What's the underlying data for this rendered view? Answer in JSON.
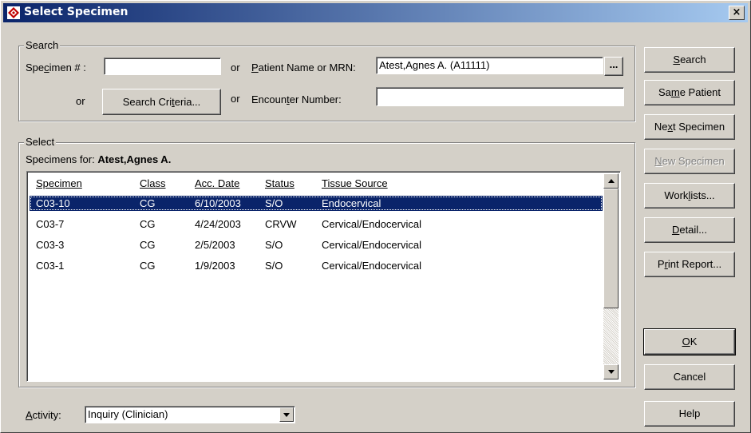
{
  "window": {
    "title": "Select Specimen",
    "close_label": "×"
  },
  "search": {
    "group_label": "Search",
    "specimen_label_pre": "Spe",
    "specimen_label_u": "c",
    "specimen_label_post": "imen # :",
    "specimen_value": "",
    "or1": "or",
    "patient_label_u": "P",
    "patient_label_post": "atient Name or MRN:",
    "patient_value": "Atest,Agnes A. (A11111)",
    "ellipsis_label": "...",
    "or2": "or",
    "criteria_pre": "Search Cri",
    "criteria_u": "t",
    "criteria_post": "eria...",
    "or3": "or",
    "encounter_pre": "Encoun",
    "encounter_u": "t",
    "encounter_post": "er Number:",
    "encounter_value": ""
  },
  "select": {
    "group_label": "Select",
    "specimens_for_label": "Specimens for:",
    "patient_name": "Atest,Agnes A.",
    "columns": [
      "Specimen",
      "Class",
      "Acc. Date",
      "Status",
      "Tissue Source"
    ],
    "rows": [
      {
        "specimen": "C03-10",
        "class": "CG",
        "acc_date": "6/10/2003",
        "status": "S/O",
        "tissue": "Endocervical"
      },
      {
        "specimen": "C03-7",
        "class": "CG",
        "acc_date": "4/24/2003",
        "status": "CRVW",
        "tissue": "Cervical/Endocervical"
      },
      {
        "specimen": "C03-3",
        "class": "CG",
        "acc_date": "2/5/2003",
        "status": "S/O",
        "tissue": "Cervical/Endocervical"
      },
      {
        "specimen": "C03-1",
        "class": "CG",
        "acc_date": "1/9/2003",
        "status": "S/O",
        "tissue": "Cervical/Endocervical"
      }
    ]
  },
  "activity": {
    "label_u": "A",
    "label_post": "ctivity:",
    "value": "Inquiry (Clinician)"
  },
  "buttons": {
    "search_u": "S",
    "search_post": "earch",
    "same_pre": "Sa",
    "same_u": "m",
    "same_post": "e Patient",
    "next_pre": "Ne",
    "next_u": "x",
    "next_post": "t Specimen",
    "new_u": "N",
    "new_post": "ew Specimen",
    "worklists_pre": "Work",
    "worklists_u": "l",
    "worklists_post": "ists...",
    "detail_u": "D",
    "detail_post": "etail...",
    "print_pre": "P",
    "print_u": "r",
    "print_post": "int Report...",
    "ok_u": "O",
    "ok_post": "K",
    "cancel": "Cancel",
    "help": "Help"
  },
  "colors": {
    "title_start": "#0a246a",
    "title_end": "#a6caf0",
    "face": "#d4d0c8",
    "selection": "#0a246a"
  }
}
